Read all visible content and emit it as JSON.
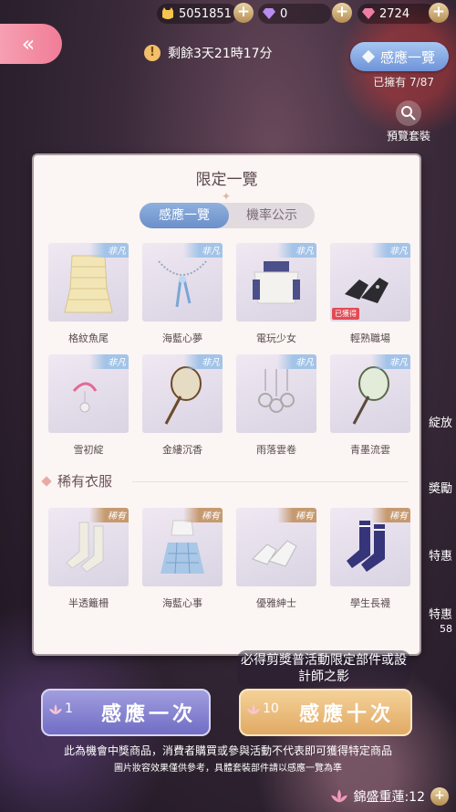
{
  "currency": {
    "gold": "5051851",
    "diamond": "0",
    "gem": "2724"
  },
  "back_icon": "«",
  "timer": {
    "icon": "!",
    "text": "剩餘3天21時17分"
  },
  "top_pill": {
    "label": "感應一覽",
    "owned": "已擁有 7/87"
  },
  "preview": {
    "label": "預覽套裝"
  },
  "panel": {
    "title": "限定一覽",
    "tabs": [
      {
        "label": "感應一覽"
      },
      {
        "label": "機率公示"
      }
    ],
    "rare_section": "稀有衣服"
  },
  "items": [
    {
      "name": "格紋魚尾",
      "badge": "非凡",
      "obtained": false,
      "icon": "skirt-icon"
    },
    {
      "name": "海藍心夢",
      "badge": "非凡",
      "obtained": false,
      "icon": "necklace-icon"
    },
    {
      "name": "電玩少女",
      "badge": "非凡",
      "obtained": false,
      "icon": "top-icon"
    },
    {
      "name": "輕熟職場",
      "badge": "非凡",
      "obtained": true,
      "obtained_label": "已獲得",
      "icon": "shoes-icon"
    },
    {
      "name": "雪初綻",
      "badge": "非凡",
      "obtained": false,
      "icon": "earring-icon"
    },
    {
      "name": "金縷沉香",
      "badge": "非凡",
      "obtained": false,
      "icon": "fan-icon"
    },
    {
      "name": "雨落雲卷",
      "badge": "非凡",
      "obtained": false,
      "icon": "pendant-icon"
    },
    {
      "name": "青墨流雲",
      "badge": "非凡",
      "obtained": false,
      "icon": "fan-icon"
    }
  ],
  "rare_items": [
    {
      "name": "半透籬柵",
      "badge": "稀有",
      "icon": "socks-icon"
    },
    {
      "name": "海藍心事",
      "badge": "稀有",
      "icon": "dress-icon"
    },
    {
      "name": "優雅紳士",
      "badge": "稀有",
      "icon": "shoes-icon"
    },
    {
      "name": "學生長襪",
      "badge": "稀有",
      "icon": "socks-icon"
    }
  ],
  "bottom_note": "必得剪獎普活動限定部件或設計師之影",
  "buttons": {
    "draw_one": {
      "count": "1",
      "label": "感應一次"
    },
    "draw_ten": {
      "count": "10",
      "label": "感應十次"
    }
  },
  "disclaimer_1": "此為機會中獎商品，消費者購買或參與活動不代表即可獲得特定商品",
  "disclaimer_2": "圖片妝容效果僅供參考，具體套裝部件請以感應一覽為準",
  "lotus": {
    "label": "錦盛重蓮:12"
  },
  "side_labels": [
    "綻放",
    "奬勵",
    "特惠",
    "特惠",
    "58"
  ],
  "colors": {
    "accent_blue": "#6b8fc9",
    "accent_pink": "#f07d97",
    "gold": "#e0a862"
  }
}
